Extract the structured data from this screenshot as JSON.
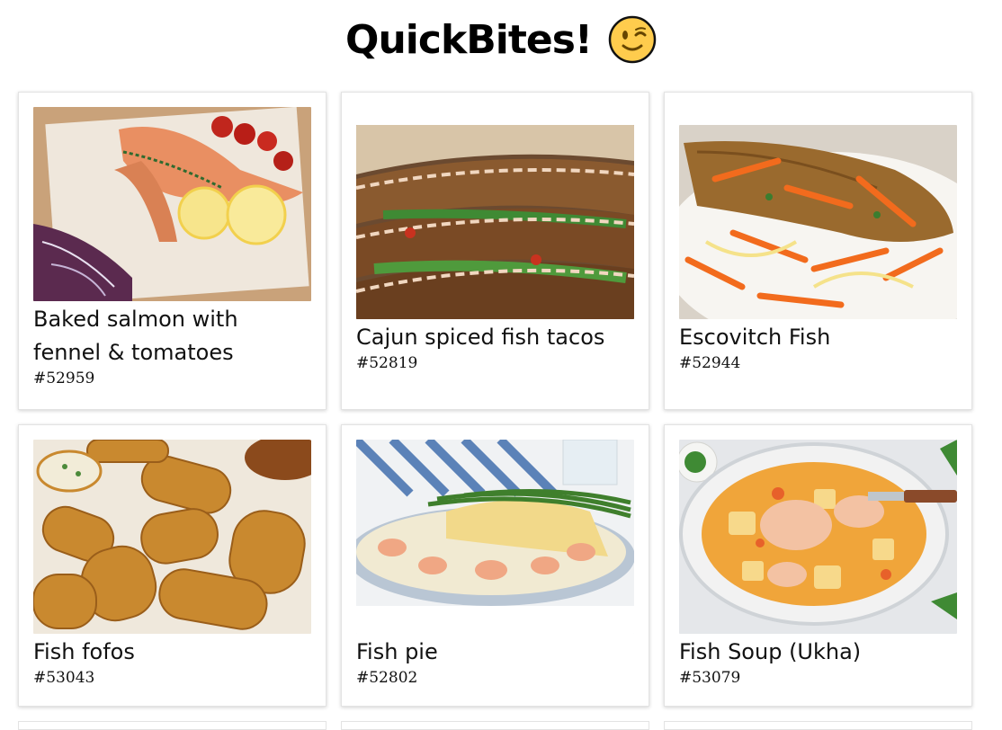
{
  "header": {
    "title": "QuickBites!",
    "emoji_icon": "winking-face-icon"
  },
  "recipes": [
    {
      "name": "Baked salmon with fennel & tomatoes",
      "id": "#52959",
      "image": "baked-salmon-photo"
    },
    {
      "name": "Cajun spiced fish tacos",
      "id": "#52819",
      "image": "fish-tacos-photo"
    },
    {
      "name": "Escovitch Fish",
      "id": "#52944",
      "image": "escovitch-fish-photo"
    },
    {
      "name": "Fish fofos",
      "id": "#53043",
      "image": "fish-fofos-photo"
    },
    {
      "name": "Fish pie",
      "id": "#52802",
      "image": "fish-pie-photo"
    },
    {
      "name": "Fish Soup (Ukha)",
      "id": "#53079",
      "image": "fish-soup-photo"
    }
  ]
}
